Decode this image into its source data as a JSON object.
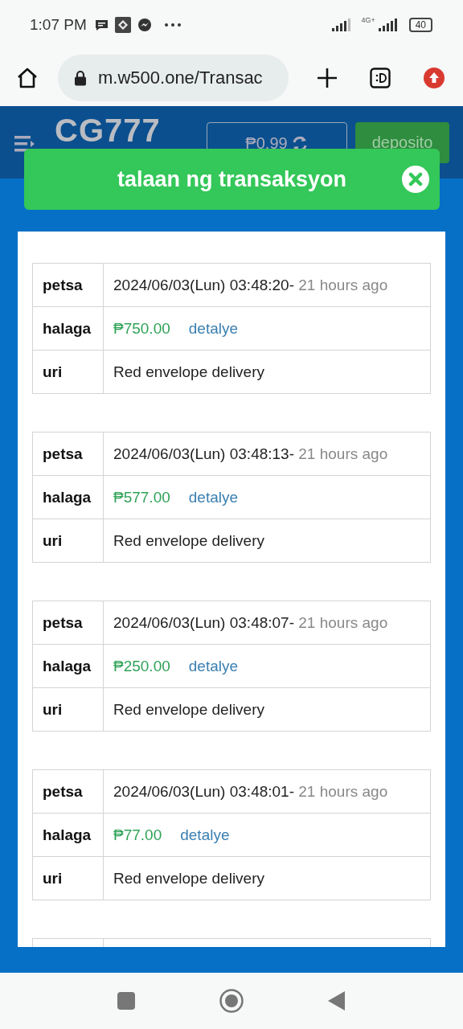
{
  "status_bar": {
    "time": "1:07 PM",
    "network": "4G+",
    "battery": "40"
  },
  "browser": {
    "url": "m.w500.one/Transac"
  },
  "header": {
    "logo": "CG777",
    "balance": "₱0.99",
    "deposit_button": "deposito"
  },
  "dialog": {
    "title": "talaan ng transaksyon"
  },
  "transactions": [
    {
      "date_label": "petsa",
      "date": "2024/06/03(Lun) 03:48:20-",
      "relative_time": "21 hours ago",
      "amount_label": "halaga",
      "amount": "₱750.00",
      "detail_link": "detalye",
      "type_label": "uri",
      "type": "Red envelope delivery"
    },
    {
      "date_label": "petsa",
      "date": "2024/06/03(Lun) 03:48:13-",
      "relative_time": "21 hours ago",
      "amount_label": "halaga",
      "amount": "₱577.00",
      "detail_link": "detalye",
      "type_label": "uri",
      "type": "Red envelope delivery"
    },
    {
      "date_label": "petsa",
      "date": "2024/06/03(Lun) 03:48:07-",
      "relative_time": "21 hours ago",
      "amount_label": "halaga",
      "amount": "₱250.00",
      "detail_link": "detalye",
      "type_label": "uri",
      "type": "Red envelope delivery"
    },
    {
      "date_label": "petsa",
      "date": "2024/06/03(Lun) 03:48:01-",
      "relative_time": "21 hours ago",
      "amount_label": "halaga",
      "amount": "₱77.00",
      "detail_link": "detalye",
      "type_label": "uri",
      "type": "Red envelope delivery"
    }
  ]
}
